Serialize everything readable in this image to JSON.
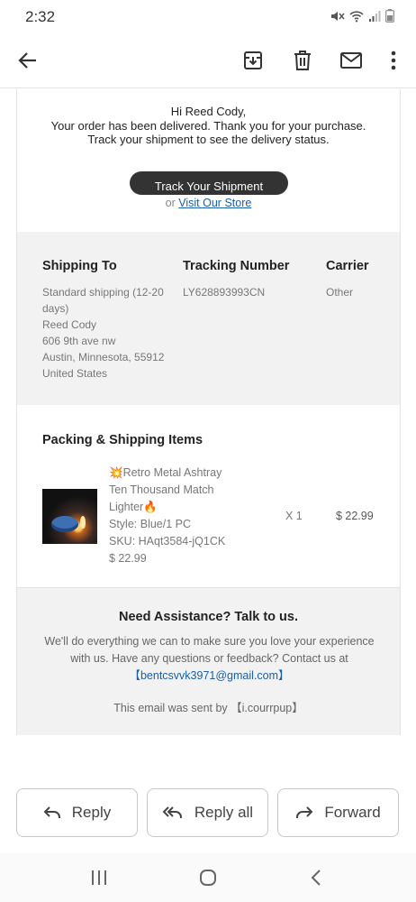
{
  "status_bar": {
    "time": "2:32"
  },
  "email": {
    "greeting_name": "Hi Reed Cody,",
    "delivered_line": "Your order has been delivered. Thank you for your purchase.",
    "track_line": "Track your shipment to see the delivery status.",
    "track_button": "Track Your Shipment",
    "or_text": "or",
    "visit_store_link": "Visit Our Store",
    "shipping": {
      "ship_to_header": "Shipping To",
      "tracking_header": "Tracking Number",
      "carrier_header": "Carrier",
      "ship_method": "Standard shipping (12-20 days)",
      "recipient": "Reed Cody",
      "street": "606 9th ave nw",
      "city_line": "Austin, Minnesota, 55912",
      "country": "United States",
      "tracking_number": "LY628893993CN",
      "carrier": "Other"
    },
    "packing_title": "Packing & Shipping Items",
    "item": {
      "name": "💥Retro Metal Ashtray Ten Thousand Match Lighter🔥",
      "style": "Style: Blue/1 PC",
      "sku": "SKU: HAqt3584-jQ1CK",
      "unit_price": "$ 22.99",
      "quantity": "X 1",
      "total": "$ 22.99"
    },
    "help": {
      "title": "Need Assistance? Talk to us.",
      "text": "We'll do everything we can to make sure you love your experience with us. Have any questions or feedback? Contact us at",
      "email_link": "【bentcsvvk3971@gmail.com】",
      "sent_by": "This email was sent by 【i.courrpup】"
    }
  },
  "actions": {
    "reply": "Reply",
    "reply_all": "Reply all",
    "forward": "Forward"
  },
  "colors": {
    "accent_link": "#1a5fa8",
    "button_dark": "#333333",
    "panel_bg": "#f2f2f2"
  }
}
